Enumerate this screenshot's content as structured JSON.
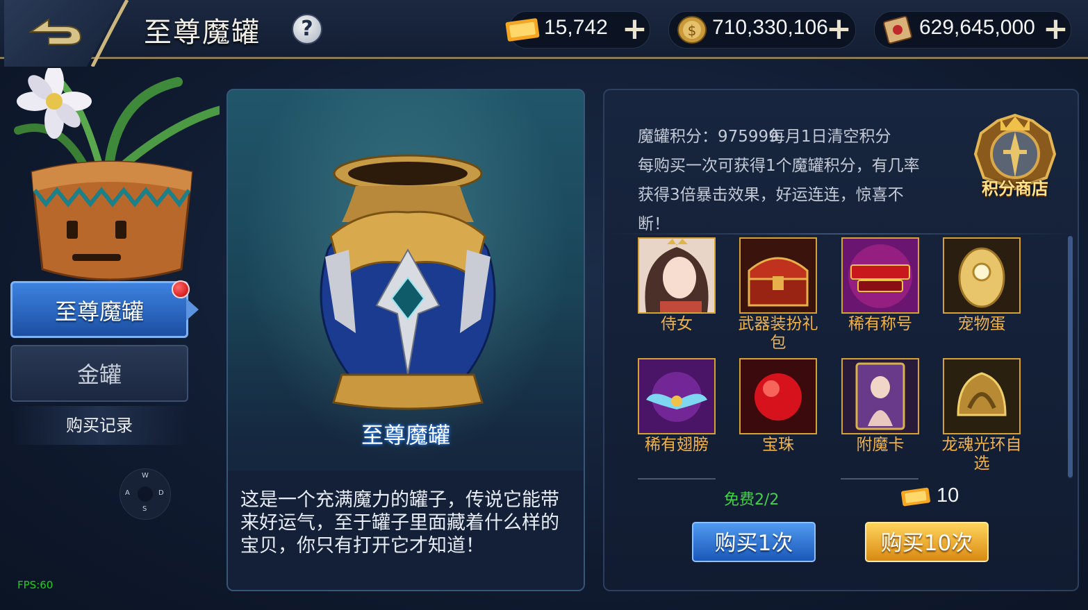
{
  "header": {
    "title": "至尊魔罐",
    "help_symbol": "?",
    "currencies": [
      {
        "icon": "gem-ticket-icon",
        "value": "15,742"
      },
      {
        "icon": "gold-coin-icon",
        "value": "710,330,106"
      },
      {
        "icon": "scroll-icon",
        "value": "629,645,000"
      }
    ],
    "plus_symbol": "+"
  },
  "sidebar": {
    "tabs": [
      {
        "label": "至尊魔罐",
        "active": true
      },
      {
        "label": "金罐",
        "active": false
      }
    ],
    "record_label": "购买记录",
    "compass": {
      "n": "W",
      "w": "A",
      "e": "D",
      "s": "S"
    },
    "fps": "FPS:60"
  },
  "jar_panel": {
    "name": "至尊魔罐",
    "description": "这是一个充满魔力的罐子，传说它能带来好运气，至于罐子里面藏着什么样的宝贝，你只有打开它才知道！"
  },
  "reward_panel": {
    "score_label": "魔罐积分：",
    "score_value": "975999",
    "score_reset": "每月1日清空积分",
    "info_text": "每购买一次可获得1个魔罐积分，有几率获得3倍暴击效果，好运连连，惊喜不断！",
    "shop_label": "积分商店",
    "items": [
      {
        "label": "侍女",
        "icon": "maid-portrait-icon"
      },
      {
        "label": "武器装扮礼包",
        "icon": "treasure-chest-icon"
      },
      {
        "label": "稀有称号",
        "icon": "rare-title-icon"
      },
      {
        "label": "宠物蛋",
        "icon": "pet-egg-icon"
      },
      {
        "label": "稀有翅膀",
        "icon": "rare-wings-icon"
      },
      {
        "label": "宝珠",
        "icon": "red-orb-icon"
      },
      {
        "label": "附魔卡",
        "icon": "enchant-card-icon"
      },
      {
        "label": "龙魂光环自选",
        "icon": "dragon-halo-icon"
      }
    ],
    "free_text": "免费2/2",
    "ten_cost": "10",
    "buy_once_label": "购买1次",
    "buy_ten_label": "购买10次"
  },
  "colors": {
    "accent_blue": "#3d82df",
    "accent_gold": "#f1b24a",
    "free_green": "#43d04b",
    "fps_green": "#1ed01e"
  }
}
